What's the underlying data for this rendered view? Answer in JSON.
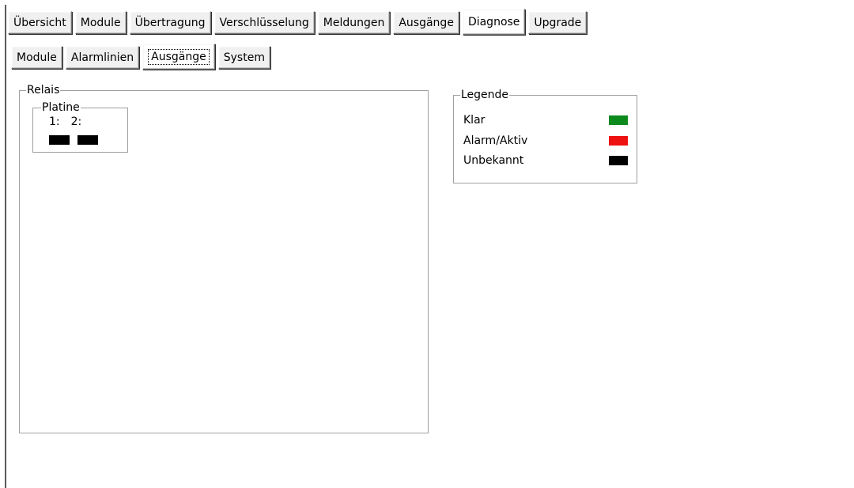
{
  "top_tabs": [
    {
      "label": "Übersicht",
      "selected": false
    },
    {
      "label": "Module",
      "selected": false
    },
    {
      "label": "Übertragung",
      "selected": false
    },
    {
      "label": "Verschlüsselung",
      "selected": false
    },
    {
      "label": "Meldungen",
      "selected": false
    },
    {
      "label": "Ausgänge",
      "selected": false
    },
    {
      "label": "Diagnose",
      "selected": true
    },
    {
      "label": "Upgrade",
      "selected": false
    }
  ],
  "sub_tabs": [
    {
      "label": "Module",
      "selected": false
    },
    {
      "label": "Alarmlinien",
      "selected": false
    },
    {
      "label": "Ausgänge",
      "selected": true
    },
    {
      "label": "System",
      "selected": false
    }
  ],
  "relais": {
    "title": "Relais",
    "platine": {
      "title": "Platine",
      "outputs": [
        {
          "label": "1:",
          "status": "unknown",
          "color": "#000000"
        },
        {
          "label": "2:",
          "status": "unknown",
          "color": "#000000"
        }
      ]
    }
  },
  "legend": {
    "title": "Legende",
    "items": [
      {
        "label": "Klar",
        "color": "#0d8a1e"
      },
      {
        "label": "Alarm/Aktiv",
        "color": "#ee1111"
      },
      {
        "label": "Unbekannt",
        "color": "#000000"
      }
    ]
  }
}
